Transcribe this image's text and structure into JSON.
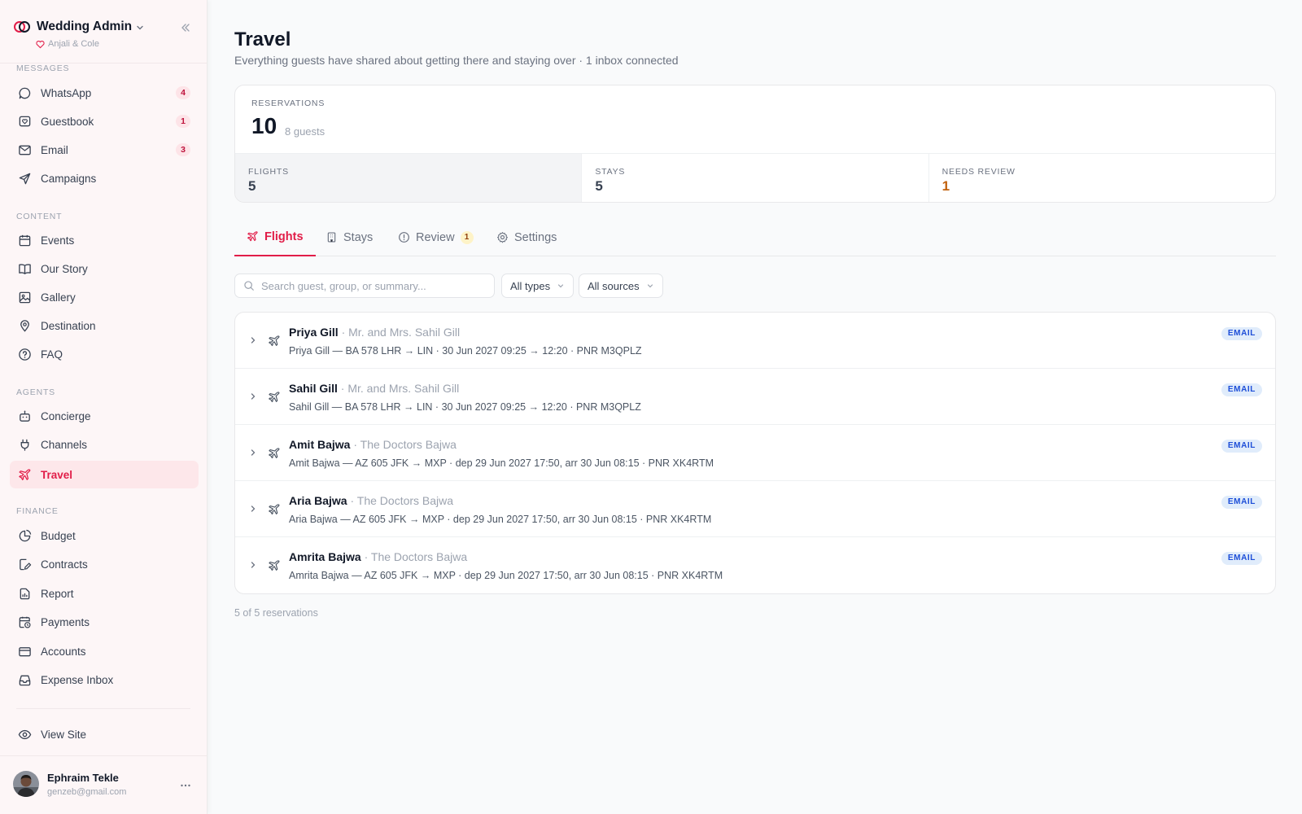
{
  "sidebar": {
    "brand_title": "Wedding Admin",
    "brand_subtitle": "Anjali & Cole",
    "sections": {
      "messages": "MESSAGES",
      "content": "CONTENT",
      "agents": "AGENTS",
      "finance": "FINANCE"
    },
    "items": {
      "whatsapp": {
        "label": "WhatsApp",
        "badge": "4"
      },
      "guestbook": {
        "label": "Guestbook",
        "badge": "1"
      },
      "email": {
        "label": "Email",
        "badge": "3"
      },
      "campaigns": {
        "label": "Campaigns"
      },
      "events": {
        "label": "Events"
      },
      "our_story": {
        "label": "Our Story"
      },
      "gallery": {
        "label": "Gallery"
      },
      "destination": {
        "label": "Destination"
      },
      "faq": {
        "label": "FAQ"
      },
      "concierge": {
        "label": "Concierge"
      },
      "channels": {
        "label": "Channels"
      },
      "travel": {
        "label": "Travel"
      },
      "budget": {
        "label": "Budget"
      },
      "contracts": {
        "label": "Contracts"
      },
      "report": {
        "label": "Report"
      },
      "payments": {
        "label": "Payments"
      },
      "accounts": {
        "label": "Accounts"
      },
      "expense_inbox": {
        "label": "Expense Inbox"
      },
      "view_site": {
        "label": "View Site"
      }
    },
    "user": {
      "name": "Ephraim Tekle",
      "email": "genzeb@gmail.com"
    }
  },
  "page": {
    "title": "Travel",
    "subtitle": "Everything guests have shared about getting there and staying over · 1 inbox connected"
  },
  "stats": {
    "reservations_label": "RESERVATIONS",
    "reservations_value": "10",
    "guests_text": "8 guests",
    "flights_label": "FLIGHTS",
    "flights_value": "5",
    "stays_label": "STAYS",
    "stays_value": "5",
    "review_label": "NEEDS REVIEW",
    "review_value": "1"
  },
  "tabs": {
    "flights": "Flights",
    "stays": "Stays",
    "review": "Review",
    "review_badge": "1",
    "settings": "Settings"
  },
  "filters": {
    "search_placeholder": "Search guest, group, or summary...",
    "type_select": "All types",
    "source_select": "All sources"
  },
  "reservations": [
    {
      "name": "Priya Gill",
      "group": " · Mr. and Mrs. Sahil Gill",
      "summary": "Priya Gill — BA 578 LHR → LIN · 30 Jun 2027 09:25 → 12:20 · PNR M3QPLZ",
      "source": "EMAIL"
    },
    {
      "name": "Sahil Gill",
      "group": " · Mr. and Mrs. Sahil Gill",
      "summary": "Sahil Gill — BA 578 LHR → LIN · 30 Jun 2027 09:25 → 12:20 · PNR M3QPLZ",
      "source": "EMAIL"
    },
    {
      "name": "Amit Bajwa",
      "group": " · The Doctors Bajwa",
      "summary": "Amit Bajwa — AZ 605 JFK → MXP · dep 29 Jun 2027 17:50, arr 30 Jun 08:15 · PNR XK4RTM",
      "source": "EMAIL"
    },
    {
      "name": "Aria Bajwa",
      "group": " · The Doctors Bajwa",
      "summary": "Aria Bajwa — AZ 605 JFK → MXP · dep 29 Jun 2027 17:50, arr 30 Jun 08:15 · PNR XK4RTM",
      "source": "EMAIL"
    },
    {
      "name": "Amrita Bajwa",
      "group": " · The Doctors Bajwa",
      "summary": "Amrita Bajwa — AZ 605 JFK → MXP · dep 29 Jun 2027 17:50, arr 30 Jun 08:15 · PNR XK4RTM",
      "source": "EMAIL"
    }
  ],
  "list_footer": "5 of 5 reservations",
  "colors": {
    "accent": "#e11d48",
    "warning": "#c2620f",
    "email_badge": "#1d4ed8"
  }
}
